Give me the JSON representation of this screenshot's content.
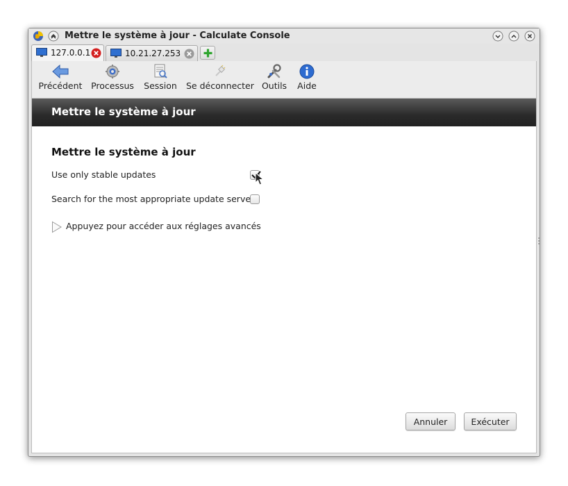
{
  "window": {
    "title": "Mettre le système à jour - Calculate Console"
  },
  "tabs": [
    {
      "label": "127.0.0.1",
      "active": true
    },
    {
      "label": "10.21.27.253",
      "active": false
    }
  ],
  "toolbar": {
    "back_label": "Précédent",
    "processes_label": "Processus",
    "session_label": "Session",
    "disconnect_label": "Se déconnecter",
    "tools_label": "Outils",
    "help_label": "Aide"
  },
  "page": {
    "header_title": "Mettre le système à jour",
    "section_title": "Mettre le système à jour",
    "options": [
      {
        "label": "Use only stable updates",
        "checked": true
      },
      {
        "label": "Search for the most appropriate update server",
        "checked": false
      }
    ],
    "advanced_label": "Appuyez pour accéder aux réglages avancés"
  },
  "buttons": {
    "cancel_label": "Annuler",
    "execute_label": "Exécuter"
  },
  "colors": {
    "header_bg": "#2a2a2a",
    "add_tab_green": "#2fa52f",
    "close_red": "#d42020"
  }
}
